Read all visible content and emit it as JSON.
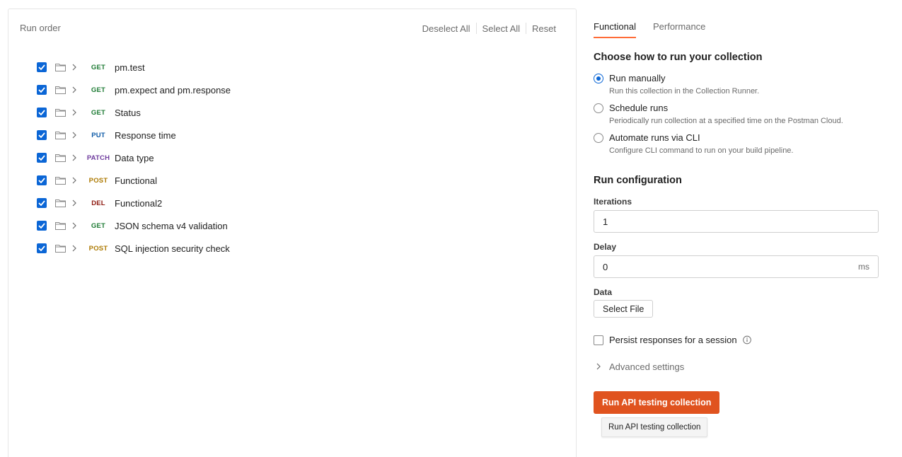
{
  "runner": {
    "title": "Run order",
    "actions": {
      "deselect_all": "Deselect All",
      "select_all": "Select All",
      "reset": "Reset"
    },
    "requests": [
      {
        "method": "GET",
        "name": "pm.test",
        "checked": true
      },
      {
        "method": "GET",
        "name": "pm.expect and pm.response",
        "checked": true
      },
      {
        "method": "GET",
        "name": "Status",
        "checked": true
      },
      {
        "method": "PUT",
        "name": "Response time",
        "checked": true
      },
      {
        "method": "PATCH",
        "name": "Data type",
        "checked": true
      },
      {
        "method": "POST",
        "name": "Functional",
        "checked": true
      },
      {
        "method": "DEL",
        "name": "Functional2",
        "checked": true
      },
      {
        "method": "GET",
        "name": "JSON schema v4 validation",
        "checked": true
      },
      {
        "method": "POST",
        "name": "SQL injection security check",
        "checked": true
      }
    ]
  },
  "tabs": [
    {
      "label": "Functional",
      "active": true
    },
    {
      "label": "Performance",
      "active": false
    }
  ],
  "run_mode": {
    "title": "Choose how to run your collection",
    "options": [
      {
        "label": "Run manually",
        "description": "Run this collection in the Collection Runner.",
        "selected": true
      },
      {
        "label": "Schedule runs",
        "description": "Periodically run collection at a specified time on the Postman Cloud.",
        "selected": false
      },
      {
        "label": "Automate runs via CLI",
        "description": "Configure CLI command to run on your build pipeline.",
        "selected": false
      }
    ]
  },
  "config": {
    "title": "Run configuration",
    "iterations_label": "Iterations",
    "iterations_value": "1",
    "delay_label": "Delay",
    "delay_value": "0",
    "delay_unit": "ms",
    "data_label": "Data",
    "select_file_label": "Select File",
    "persist_label": "Persist responses for a session",
    "persist_checked": false,
    "advanced_label": "Advanced settings"
  },
  "run_button": {
    "label": "Run API testing collection",
    "tooltip": "Run API testing collection"
  },
  "colors": {
    "accent_orange": "#e0531f",
    "tab_underline": "#ff6c37",
    "checkbox_blue": "#0b66d6",
    "method_get": "#1e7b34",
    "method_put": "#0d5aa7",
    "method_patch": "#6f3c9e",
    "method_post": "#ad7a03",
    "method_del": "#8e1a10"
  },
  "icons": {
    "checkbox": "check-icon",
    "folder": "folder-icon",
    "expand": "chevron-right-icon",
    "info": "info-icon"
  }
}
